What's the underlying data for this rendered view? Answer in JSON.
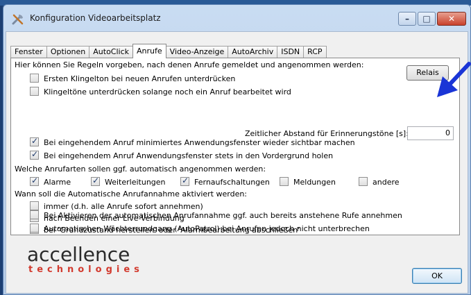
{
  "window": {
    "title": "Konfiguration Videoarbeitsplatz",
    "controls": {
      "minimize": "–",
      "maximize": "□",
      "close": "✕"
    }
  },
  "tabs": [
    "Fenster",
    "Optionen",
    "AutoClick",
    "Anrufe",
    "Video-Anzeige",
    "AutoArchiv",
    "ISDN",
    "RCP"
  ],
  "active_tab": "Anrufe",
  "panel": {
    "intro": "Hier können Sie Regeln vorgeben, nach denen Anrufe gemeldet und angenommen werden:",
    "relais_button": "Relais",
    "rules": [
      {
        "label": "Ersten Klingelton bei neuen Anrufen unterdrücken",
        "checked": false
      },
      {
        "label": "Klingeltöne unterdrücken solange noch ein Anruf bearbeitet wird",
        "checked": false
      }
    ],
    "reminder_label": "Zeitlicher Abstand für Erinnerungstöne [s]:",
    "reminder_value": "0",
    "window_rules": [
      {
        "label": "Bei eingehendem Anruf minimiertes Anwendungsfenster wieder sichtbar machen",
        "checked": true
      },
      {
        "label": "Bei eingehendem Anruf Anwendungsfenster stets in den Vordergrund holen",
        "checked": true
      }
    ],
    "auto_accept_heading": "Welche Anrufarten sollen ggf. automatisch angenommen werden:",
    "call_types": [
      {
        "label": "Alarme",
        "checked": true
      },
      {
        "label": "Weiterleitungen",
        "checked": true
      },
      {
        "label": "Fernaufschaltungen",
        "checked": true
      },
      {
        "label": "Meldungen",
        "checked": false
      },
      {
        "label": "andere",
        "checked": false
      }
    ],
    "activation_heading": "Wann soll die Automatische Anrufannahme aktiviert werden:",
    "activation_options": [
      {
        "label": "immer (d.h. alle Anrufe sofort annehmen)",
        "checked": false
      },
      {
        "label": "nach Beenden einer Live-Verbindung",
        "checked": false
      },
      {
        "label": "bei 'Grundzustand herstellen' oder 'Alarmbearbeitung abschließen'",
        "checked": true
      }
    ]
  },
  "outer_options": [
    {
      "label": "Bei Aktivieren der automatischen Anrufannahme ggf. auch bereits anstehene Rufe annehmen",
      "checked": false
    },
    {
      "label": "Automatischen Wächterrundgang (AutoPatrol) bei Anrufen jedoch nicht unterbrechen",
      "checked": false
    }
  ],
  "logo": {
    "main": "accellence",
    "sub": "technologies"
  },
  "ok_button": "OK",
  "colors": {
    "annotation_arrow": "#1a35d6",
    "logo_red": "#d23a2e"
  }
}
